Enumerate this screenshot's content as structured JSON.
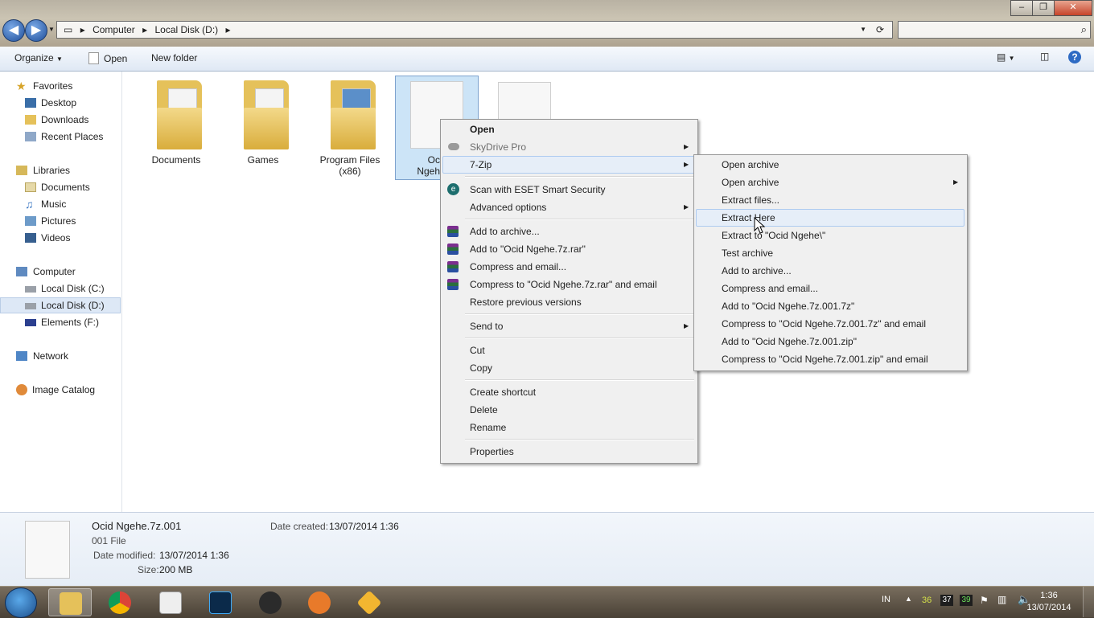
{
  "window": {
    "address": [
      "Computer",
      "Local Disk (D:)"
    ],
    "controls": [
      "–",
      "❐",
      "✕"
    ]
  },
  "toolbar": {
    "organize": "Organize",
    "open": "Open",
    "new_folder": "New folder"
  },
  "sidebar": {
    "favorites": "Favorites",
    "desktop": "Desktop",
    "downloads": "Downloads",
    "recent": "Recent Places",
    "libraries": "Libraries",
    "documents": "Documents",
    "music": "Music",
    "pictures": "Pictures",
    "videos": "Videos",
    "computer": "Computer",
    "disk_c": "Local Disk (C:)",
    "disk_d": "Local Disk (D:)",
    "elements": "Elements (F:)",
    "network": "Network",
    "image_catalog": "Image Catalog"
  },
  "files": {
    "documents": "Documents",
    "games": "Games",
    "program_files_1": "Program Files",
    "program_files_2": "(x86)",
    "ocid_1": "Ocid",
    "ocid_2": "Ngehe.7z"
  },
  "context_menu": {
    "open": "Open",
    "skydrive": "SkyDrive Pro",
    "sevenzip": "7-Zip",
    "eset": "Scan with ESET Smart Security",
    "advanced": "Advanced options",
    "add_archive": "Add to archive...",
    "add_rar": "Add to \"Ocid Ngehe.7z.rar\"",
    "compress_email": "Compress and email...",
    "compress_rar_email": "Compress to \"Ocid Ngehe.7z.rar\" and email",
    "restore": "Restore previous versions",
    "send_to": "Send to",
    "cut": "Cut",
    "copy": "Copy",
    "create_shortcut": "Create shortcut",
    "delete": "Delete",
    "rename": "Rename",
    "properties": "Properties"
  },
  "submenu": {
    "open_archive": "Open archive",
    "open_archive_2": "Open archive",
    "extract_files": "Extract files...",
    "extract_here": "Extract Here",
    "extract_to": "Extract to \"Ocid Ngehe\\\"",
    "test_archive": "Test archive",
    "add_archive": "Add to archive...",
    "compress_email": "Compress and email...",
    "add_7z": "Add to \"Ocid Ngehe.7z.001.7z\"",
    "compress_7z_email": "Compress to \"Ocid Ngehe.7z.001.7z\" and email",
    "add_zip": "Add to \"Ocid Ngehe.7z.001.zip\"",
    "compress_zip_email": "Compress to \"Ocid Ngehe.7z.001.zip\" and email"
  },
  "details": {
    "name": "Ocid Ngehe.7z.001",
    "type": "001 File",
    "date_modified_label": "Date modified:",
    "date_modified": "13/07/2014 1:36",
    "size_label": "Size:",
    "size": "200 MB",
    "date_created_label": "Date created:",
    "date_created": "13/07/2014 1:36"
  },
  "taskbar": {
    "lang": "IN",
    "tray_nums": [
      "36",
      "37",
      "39"
    ],
    "time": "1:36",
    "date": "13/07/2014"
  }
}
